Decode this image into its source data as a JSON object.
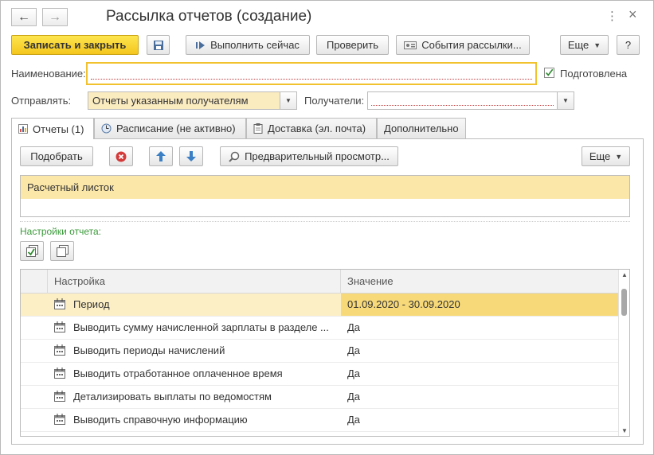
{
  "window": {
    "title": "Рассылка отчетов (создание)",
    "back_icon": "←",
    "forward_icon": "→",
    "more_icon": "⋮",
    "close_icon": "×"
  },
  "toolbar": {
    "save_close_label": "Записать и закрыть",
    "run_now_label": "Выполнить сейчас",
    "check_label": "Проверить",
    "events_label": "События рассылки...",
    "more_label": "Еще",
    "help_label": "?"
  },
  "form": {
    "name_label": "Наименование:",
    "name_value": "",
    "prepared_label": "Подготовлена",
    "prepared_checked": true,
    "send_label": "Отправлять:",
    "send_value": "Отчеты указанным получателям",
    "recipients_label": "Получатели:",
    "recipients_value": ""
  },
  "tabs": [
    {
      "label": "Отчеты (1)",
      "icon": "report-icon",
      "active": true
    },
    {
      "label": "Расписание (не активно)",
      "icon": "clock-icon",
      "active": false
    },
    {
      "label": "Доставка (эл. почта)",
      "icon": "clipboard-icon",
      "active": false
    },
    {
      "label": "Дополнительно",
      "icon": "",
      "active": false
    }
  ],
  "reports_panel": {
    "pick_label": "Подобрать",
    "preview_label": "Предварительный просмотр...",
    "more_label": "Еще",
    "reports": [
      "Расчетный листок"
    ],
    "settings_label": "Настройки отчета:"
  },
  "settings_grid": {
    "columns": [
      "Настройка",
      "Значение"
    ],
    "rows": [
      {
        "name": "Период",
        "value": "01.09.2020 - 30.09.2020",
        "selected": true
      },
      {
        "name": "Выводить сумму начисленной зарплаты в разделе ...",
        "value": "Да",
        "selected": false
      },
      {
        "name": "Выводить периоды начислений",
        "value": "Да",
        "selected": false
      },
      {
        "name": "Выводить отработанное оплаченное время",
        "value": "Да",
        "selected": false
      },
      {
        "name": "Детализировать выплаты по ведомостям",
        "value": "Да",
        "selected": false
      },
      {
        "name": "Выводить справочную информацию",
        "value": "Да",
        "selected": false
      }
    ]
  },
  "colors": {
    "primary_button": "#f4c61d",
    "selection": "#fbe7a8",
    "section_label": "#3b9a3b",
    "focus_border": "#f2c12e"
  }
}
